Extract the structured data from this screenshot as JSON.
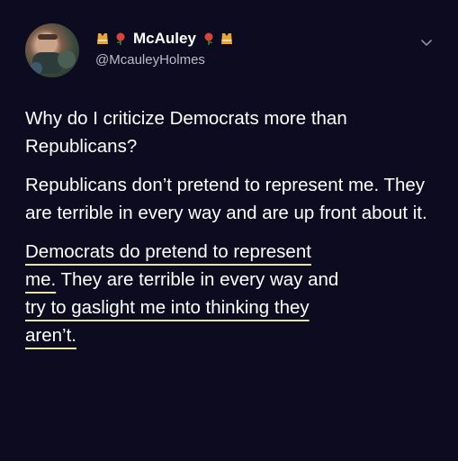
{
  "author": {
    "display_name": "McAuley",
    "handle": "@McauleyHolmes",
    "emojis_before": [
      "vest-emoji",
      "rose-emoji"
    ],
    "emojis_after": [
      "rose-emoji",
      "vest-emoji"
    ]
  },
  "tweet": {
    "para1": "Why do I criticize Democrats more than Republicans?",
    "para2": "Republicans don’t pretend to represent me. They are terrible in every way and are up front about it.",
    "para3_lines": [
      "Democrats do pretend to represent",
      "me. They are terrible in every way and",
      "try to gaslight me into thinking they",
      "aren’t."
    ]
  },
  "colors": {
    "background": "#0d0b1f",
    "text": "#ffffff",
    "handle": "#b8bcc6",
    "underline": "#e9e4a6"
  }
}
